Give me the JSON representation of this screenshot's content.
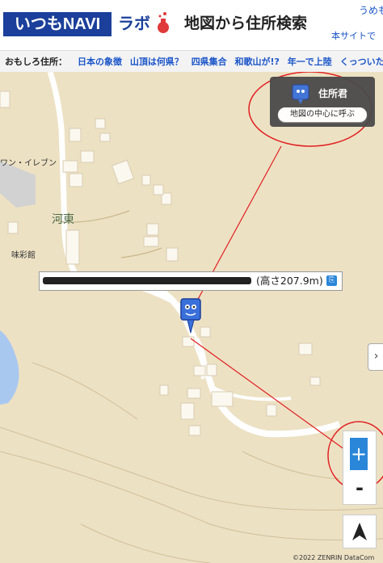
{
  "header": {
    "logo": "いつもNAVI",
    "labo": "ラボ",
    "title": "地図から住所検索",
    "link_umekita": "うめもI",
    "link_honsite": "本サイトで"
  },
  "topicbar": {
    "label": "おもしろ住所：",
    "links": [
      "日本の象徴",
      "山頂は何県？",
      "四県集合",
      "和歌山が!?",
      "年一で上陸",
      "くっついた"
    ]
  },
  "widget": {
    "name": "住所君",
    "button": "地図の中心に呼ぶ"
  },
  "info": {
    "height_text": "(高さ207.9m)"
  },
  "map_labels": {
    "eleven": "ワン・イレブン",
    "kawahigashi": "河東",
    "misaikan": "味彩館"
  },
  "controls": {
    "zoom_in": "+",
    "zoom_out": "-",
    "side_tab": "›"
  },
  "copyright": "©2022 ZENRIN DataCom",
  "colors": {
    "brand_blue": "#1b3f9a",
    "accent_blue": "#2a86d8",
    "map_bg": "#ede1c4",
    "annotation_red": "#e02020"
  }
}
